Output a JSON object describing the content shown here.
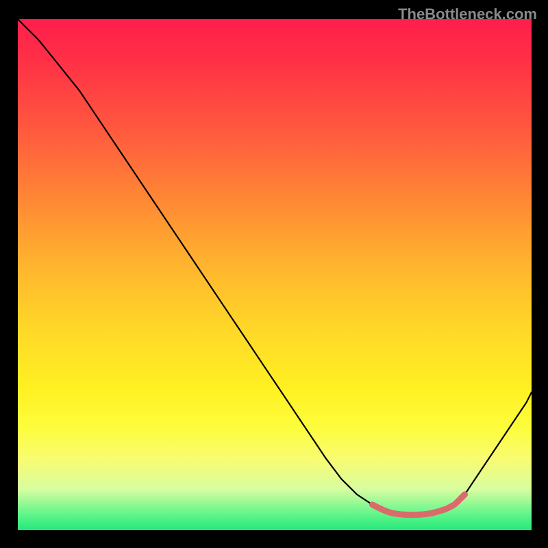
{
  "watermark": "TheBottleneck.com",
  "colors": {
    "background": "#000000",
    "curve": "#000000",
    "marker": "#d96b6b",
    "gradient_top": "#ff1e4c",
    "gradient_bottom": "#23e87a"
  },
  "chart_data": {
    "type": "line",
    "title": "",
    "xlabel": "",
    "ylabel": "",
    "xlim": [
      0,
      100
    ],
    "ylim": [
      0,
      100
    ],
    "grid": false,
    "legend": false,
    "x": [
      0,
      4,
      8,
      12,
      16,
      20,
      24,
      28,
      32,
      36,
      40,
      44,
      48,
      52,
      56,
      60,
      63,
      66,
      69,
      71,
      73,
      75,
      77,
      79,
      81,
      83,
      85,
      87,
      89,
      91,
      93,
      95,
      97,
      99,
      100
    ],
    "values": [
      100,
      96,
      91,
      86,
      80,
      74,
      68,
      62,
      56,
      50,
      44,
      38,
      32,
      26,
      20,
      14,
      10,
      7,
      5,
      4,
      3,
      3,
      3,
      3,
      3,
      4,
      5,
      7,
      10,
      13,
      16,
      19,
      22,
      25,
      27
    ],
    "markers": {
      "x": [
        69,
        70,
        71,
        72,
        73,
        74.5,
        76,
        77.5,
        79,
        80.5,
        82,
        83.5,
        85,
        86,
        87
      ],
      "y": [
        5,
        4.5,
        4,
        3.6,
        3.3,
        3.1,
        3.0,
        3.0,
        3.1,
        3.3,
        3.7,
        4.2,
        5.0,
        6.0,
        7.0
      ]
    }
  }
}
